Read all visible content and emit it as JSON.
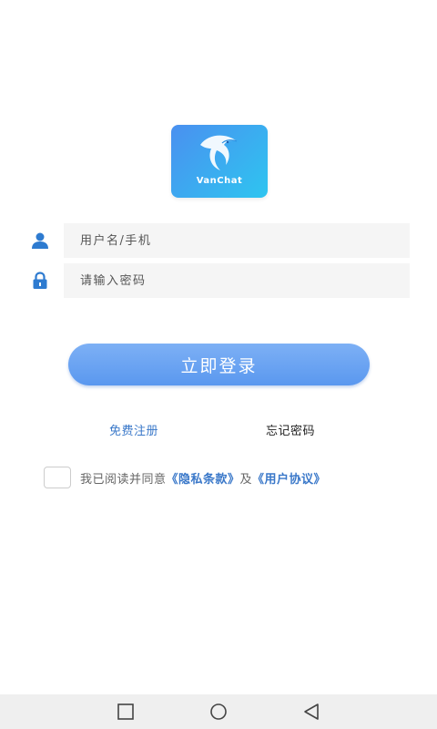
{
  "app": {
    "logo_text": "VanChat"
  },
  "login": {
    "username_placeholder": "用户名/手机",
    "password_placeholder": "请输入密码",
    "submit_label": "立即登录",
    "register_label": "免费注册",
    "forgot_label": "忘记密码"
  },
  "agreement": {
    "prefix": "我已阅读并同意",
    "privacy_label": "《隐私条款》",
    "joiner": "及",
    "terms_label": "《用户协议》",
    "checked": false
  },
  "colors": {
    "accent": "#5a98ef",
    "link": "#3a78c9",
    "icon": "#2e7bd0"
  },
  "icons": {
    "user": "user-icon",
    "lock": "lock-icon",
    "recent_apps": "square-icon",
    "home": "circle-icon",
    "back": "triangle-back-icon"
  }
}
